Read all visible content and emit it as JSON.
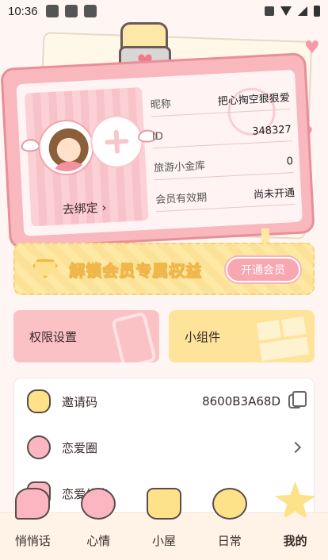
{
  "status_bar": {
    "time": "10:36"
  },
  "profile_card": {
    "bind_link": "去绑定",
    "fields": [
      {
        "label": "昵称",
        "value": "把心掏空狠狠爱"
      },
      {
        "label": "ID",
        "value": "348327"
      },
      {
        "label": "旅游小金库",
        "value": "0"
      },
      {
        "label": "会员有效期",
        "value": "尚未开通"
      }
    ]
  },
  "vip_banner": {
    "text": "解锁会员专属权益",
    "button": "开通会员"
  },
  "tiles": {
    "permissions": "权限设置",
    "widget": "小组件"
  },
  "list": {
    "invite_label": "邀请码",
    "invite_code": "8600B3A68D",
    "circle_label": "恋爱圈",
    "info_label": "恋爱信息"
  },
  "nav": [
    {
      "label": "悄悄话",
      "icon": "chat-bubble-heart-icon"
    },
    {
      "label": "心情",
      "icon": "mood-face-icon"
    },
    {
      "label": "小屋",
      "icon": "house-icon"
    },
    {
      "label": "日常",
      "icon": "daily-clock-icon"
    },
    {
      "label": "我的",
      "icon": "mine-star-icon"
    }
  ],
  "colors": {
    "card_pink": "#f8b8be",
    "accent_yellow": "#fde49a",
    "nav_bg": "#fff3e8"
  }
}
